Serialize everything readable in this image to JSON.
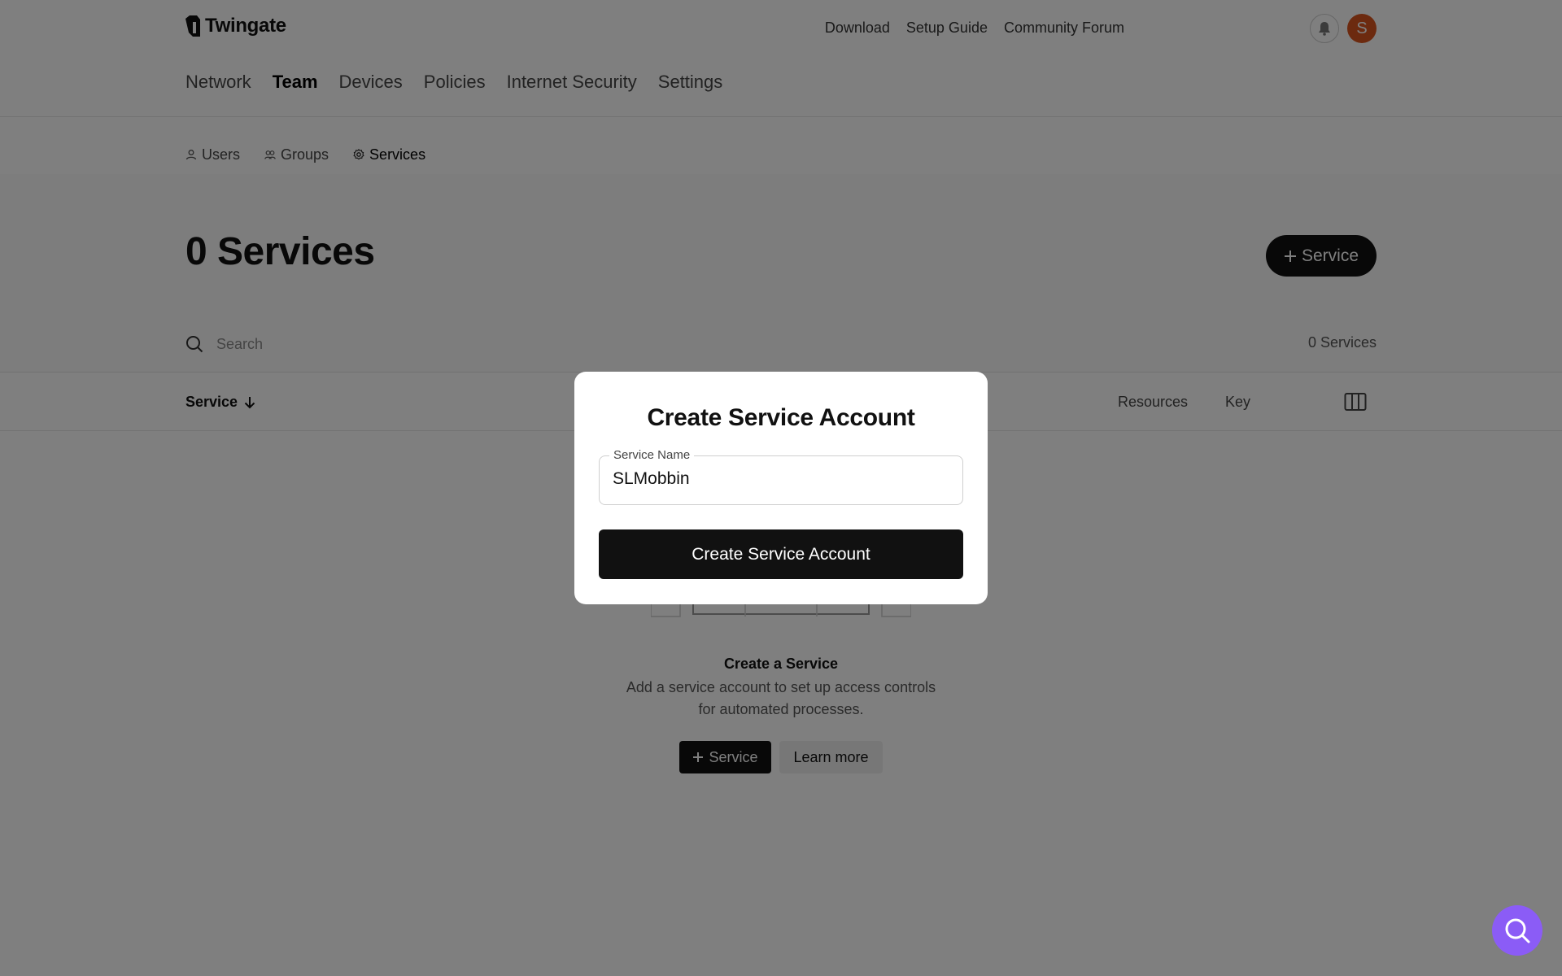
{
  "brand": {
    "name": "Twingate"
  },
  "top_links": [
    "Download",
    "Setup Guide",
    "Community Forum"
  ],
  "avatar": {
    "initial": "S",
    "color": "#d9541f"
  },
  "main_nav": [
    {
      "label": "Network",
      "active": false
    },
    {
      "label": "Team",
      "active": true
    },
    {
      "label": "Devices",
      "active": false
    },
    {
      "label": "Policies",
      "active": false
    },
    {
      "label": "Internet Security",
      "active": false
    },
    {
      "label": "Settings",
      "active": false
    }
  ],
  "sub_nav": [
    {
      "label": "Users",
      "icon": "user-icon",
      "active": false
    },
    {
      "label": "Groups",
      "icon": "users-icon",
      "active": false
    },
    {
      "label": "Services",
      "icon": "gear-icon",
      "active": true
    }
  ],
  "page": {
    "title": "0 Services",
    "add_button": "Service",
    "search_placeholder": "Search",
    "count": "0 Services"
  },
  "table": {
    "col_service": "Service",
    "col_resources": "Resources",
    "col_key": "Key"
  },
  "empty_state": {
    "title": "Create a Service",
    "description": "Add a service account to set up access controls for automated processes.",
    "add_button": "Service",
    "learn_button": "Learn more"
  },
  "modal": {
    "title": "Create Service Account",
    "field_label": "Service Name",
    "field_value": "SLMobbin",
    "submit": "Create Service Account"
  },
  "colors": {
    "accent": "#111111",
    "chat": "#8b5cf6"
  }
}
